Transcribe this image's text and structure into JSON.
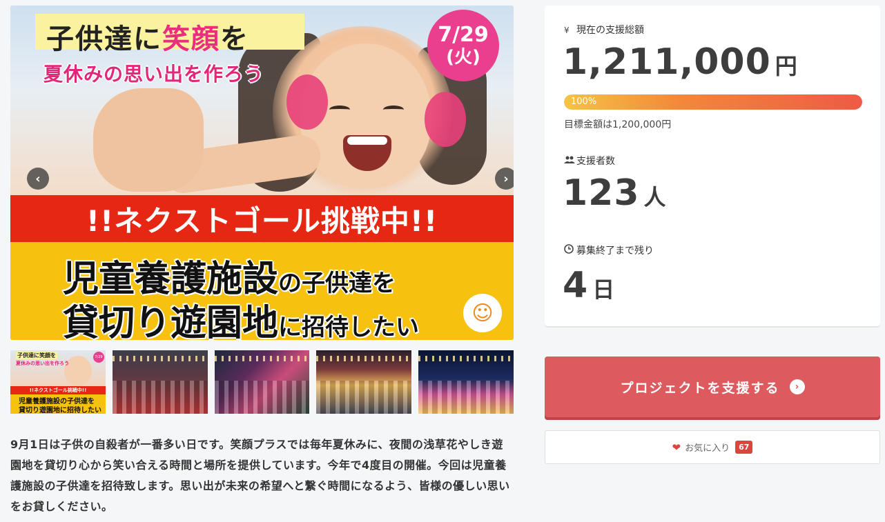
{
  "hero": {
    "title_part1": "子供達に",
    "title_highlight": "笑顔",
    "title_part2": "を",
    "subtitle": "夏休みの思い出を作ろう",
    "date": "7/29",
    "weekday": "(火)",
    "banner_red": "!!ネクストゴール挑戦中!!",
    "line1_big": "児童養護施設",
    "line1_small": "の子供達を",
    "line2_big": "貸切り遊園地",
    "line2_small": "に招待したい",
    "prev_icon": "chevron-left-icon",
    "next_icon": "chevron-right-icon"
  },
  "thumbnails": {
    "first": {
      "title": "子供達に笑顔を",
      "subtitle": "夏休みの思い出を作ろう",
      "date": "7/29",
      "banner": "!!ネクストゴール挑戦中!!",
      "line1": "児童養護施設の子供達を",
      "line2": "貸切り遊園地に招待したい"
    }
  },
  "description": "9月1日は子供の自殺者が一番多い日です。笑顔プラスでは毎年夏休みに、夜間の浅草花やしき遊園地を貸切り心から笑い合える時間と場所を提供しています。今年で4度目の開催。今回は児童養護施設の子供達を招待致します。思い出が未来の希望へと繋ぐ時間になるよう、皆様の優しい思いをお貸しください。",
  "stats": {
    "total_icon": "¥",
    "total_label": "現在の支援総額",
    "total_amount": "1,211,000",
    "total_unit": "円",
    "progress_percent": 100,
    "progress_label": "100%",
    "goal_text": "目標金額は1,200,000円",
    "backers_icon": "users-icon",
    "backers_label": "支援者数",
    "backers_count": "123",
    "backers_unit": "人",
    "remaining_icon": "clock-icon",
    "remaining_label": "募集終了まで残り",
    "remaining_count": "4",
    "remaining_unit": "日"
  },
  "actions": {
    "support_label": "プロジェクトを支援する",
    "support_icon": "arrow-right-circle-icon",
    "favorite_label": "お気に入り",
    "favorite_count": "67",
    "favorite_icon": "heart-icon"
  },
  "colors": {
    "accent": "#dd5b5e",
    "badge": "#d9453f",
    "progress_start": "#f5c345",
    "progress_end": "#ee5a46"
  }
}
